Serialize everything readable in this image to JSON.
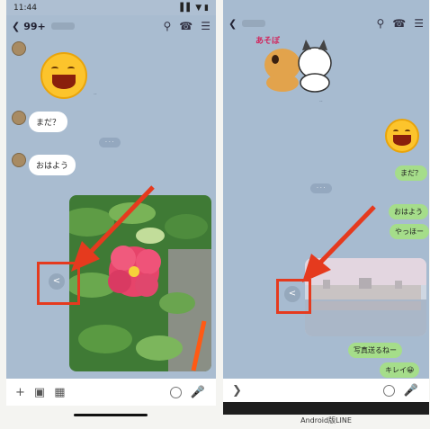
{
  "left": {
    "status_time": "11:44",
    "status_icons": "▌▌ ▼ ▮",
    "back_icon": "chevron-left",
    "unread_count": "99+",
    "header_icons": [
      "search-icon",
      "phone-icon",
      "menu-icon"
    ],
    "messages": [
      {
        "text": "まだ？"
      },
      {
        "text": "おはよう"
      }
    ],
    "composer_icons": [
      "plus-icon",
      "camera-icon",
      "image-icon",
      "emoji-icon",
      "mic-icon"
    ]
  },
  "right": {
    "back_icon": "chevron-left",
    "header_icons": [
      "search-icon",
      "phone-icon",
      "menu-icon"
    ],
    "sticker_text": "あそぼ",
    "messages": [
      {
        "text": "まだ？"
      },
      {
        "text": "おはよう"
      },
      {
        "text": "やっほー"
      },
      {
        "text": "写真送るねー"
      },
      {
        "text": "キレイ😀"
      }
    ],
    "composer_icons": [
      "chevron-right-icon",
      "emoji-icon",
      "mic-icon"
    ]
  },
  "caption": "Android版LINE",
  "colors": {
    "chat_bg": "#a9bcd0",
    "sent_bubble": "#a5dd8a",
    "highlight": "#e53a1e"
  }
}
